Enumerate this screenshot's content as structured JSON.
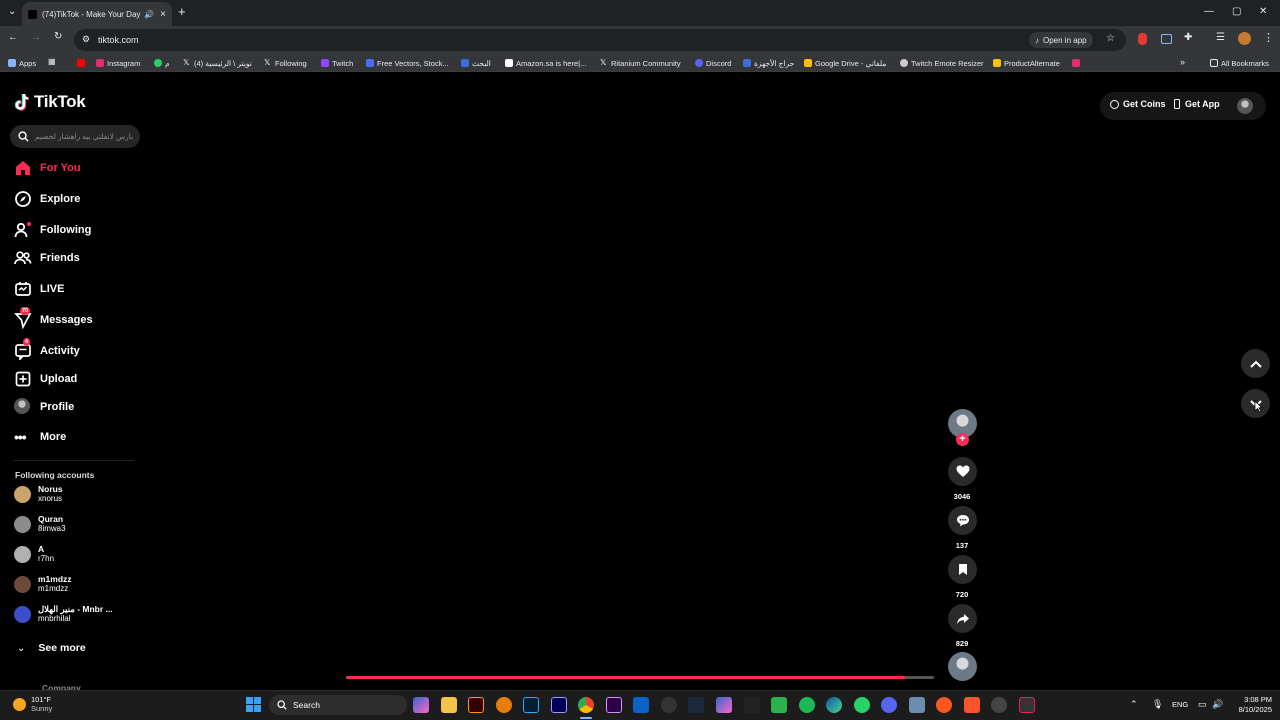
{
  "browser": {
    "tab_title": "(74)TikTok - Make Your Day",
    "url": "tiktok.com",
    "open_in_app": "Open in app",
    "all_bookmarks": "All Bookmarks",
    "bookmarks": [
      {
        "label": "Apps",
        "color": "#8ab4f8"
      },
      {
        "label": "",
        "color": "#ff0000"
      },
      {
        "label": "Instagram",
        "color": "#e1306c"
      },
      {
        "label": "م",
        "color": "#25d366"
      },
      {
        "label": "تويتر \\ الرئيسية (4)",
        "color": "#ffffff"
      },
      {
        "label": "Following",
        "color": "#ffffff"
      },
      {
        "label": "Twitch",
        "color": "#9146ff"
      },
      {
        "label": "Free Vectors, Stock...",
        "color": "#4a6cf7"
      },
      {
        "label": "البحث",
        "color": "#3b6fd8"
      },
      {
        "label": "Amazon.sa is here|...",
        "color": "#ffffff"
      },
      {
        "label": "Ritanium Community",
        "color": "#ffffff"
      },
      {
        "label": "Discord",
        "color": "#5865f2"
      },
      {
        "label": "حراج الأجهزة",
        "color": "#3b6fd8"
      },
      {
        "label": "Google Drive - ملفاتي",
        "color": "#fbbc04"
      },
      {
        "label": "Twitch Emote Resizer",
        "color": "#cccccc"
      },
      {
        "label": "ProductAlternate",
        "color": "#f4c20d"
      },
      {
        "label": "",
        "color": "#e1306c"
      }
    ]
  },
  "app": {
    "logo": "TikTok",
    "search_placeholder": "بارس لانفلتي بيه راهشار لخصيم",
    "get_coins": "Get Coins",
    "get_app": "Get App",
    "nav": [
      {
        "label": "For You",
        "active": true
      },
      {
        "label": "Explore"
      },
      {
        "label": "Following"
      },
      {
        "label": "Friends"
      },
      {
        "label": "LIVE"
      },
      {
        "label": "Messages",
        "badge": "70"
      },
      {
        "label": "Activity",
        "badge": "4"
      },
      {
        "label": "Upload"
      },
      {
        "label": "Profile"
      },
      {
        "label": "More"
      }
    ],
    "following_header": "Following accounts",
    "accounts": [
      {
        "name": "Norus",
        "username": "xnorus",
        "color": "#c9a36b"
      },
      {
        "name": "Quran",
        "username": "8imwa3",
        "color": "#8c8c8c"
      },
      {
        "name": "A",
        "username": "r7hn",
        "color": "#b0b0b0"
      },
      {
        "name": "m1mdzz",
        "username": "m1mdzz",
        "color": "#6b4a3a"
      },
      {
        "name": "منير الهلال - Mnbr ...",
        "username": "mnbrhilal",
        "color": "#3a4fc9"
      }
    ],
    "see_more": "See more",
    "company": "Company",
    "actions": {
      "likes": "3046",
      "comments": "137",
      "saves": "720",
      "shares": "829"
    },
    "accent": "#fe2c55"
  },
  "taskbar": {
    "weather_temp": "101°F",
    "weather_desc": "Sunny",
    "search": "Search",
    "lang": "ENG",
    "time": "3:08 PM",
    "date": "8/10/2025"
  }
}
